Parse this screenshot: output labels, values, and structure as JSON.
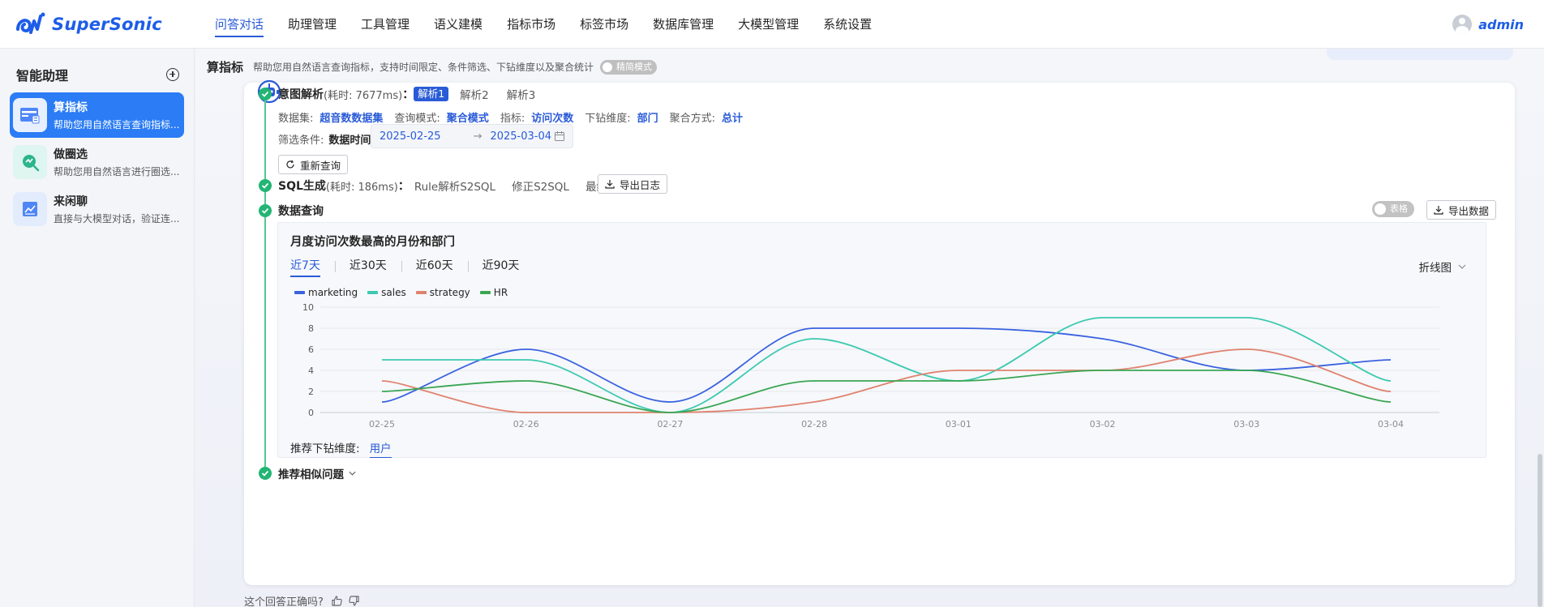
{
  "app": {
    "name": "SuperSonic",
    "user": "admin"
  },
  "nav": [
    {
      "label": "问答对话",
      "active": true
    },
    {
      "label": "助理管理"
    },
    {
      "label": "工具管理"
    },
    {
      "label": "语义建模"
    },
    {
      "label": "指标市场"
    },
    {
      "label": "标签市场"
    },
    {
      "label": "数据库管理"
    },
    {
      "label": "大模型管理"
    },
    {
      "label": "系统设置"
    }
  ],
  "sidebar": {
    "title": "智能助理",
    "agents": [
      {
        "name": "算指标",
        "desc": "帮助您用自然语言查询指标...",
        "active": true,
        "icon": "metric-card-icon"
      },
      {
        "name": "做圈选",
        "desc": "帮助您用自然语言进行圈选...",
        "icon": "search-chart-icon"
      },
      {
        "name": "来闲聊",
        "desc": "直接与大模型对话，验证连...",
        "icon": "chat-chart-icon"
      }
    ]
  },
  "topbar": {
    "title": "算指标",
    "desc": "帮助您用自然语言查询指标，支持时间限定、条件筛选、下钻维度以及聚合统计",
    "simple_mode": "精简模式"
  },
  "intent": {
    "title": "意图解析",
    "elapsed": "(耗时: 7677ms)",
    "colon": "：",
    "parses": [
      "解析1",
      "解析2",
      "解析3"
    ],
    "dataset_label": "数据集:",
    "dataset": "超音数数据集",
    "query_mode_label": "查询模式:",
    "query_mode": "聚合模式",
    "metric_label": "指标:",
    "metric": "访问次数",
    "drill_label": "下钻维度:",
    "drill": "部门",
    "agg_label": "聚合方式:",
    "agg": "总计",
    "filter_label": "筛选条件:",
    "date_label": "数据时间:",
    "date_start": "2025-02-25",
    "date_sep": "→",
    "date_end": "2025-03-04",
    "requery": "重新查询"
  },
  "sql": {
    "title": "SQL生成",
    "elapsed": "(耗时: 186ms)",
    "colon": "：",
    "items": [
      "Rule解析S2SQL",
      "修正S2SQL",
      "最终执行SQL"
    ],
    "export_log": "导出日志"
  },
  "query": {
    "title": "数据查询",
    "table_toggle": "表格",
    "export_data": "导出数据"
  },
  "chart_panel": {
    "title": "月度访问次数最高的月份和部门",
    "ranges": [
      "近7天",
      "近30天",
      "近60天",
      "近90天"
    ],
    "chart_type": "折线图",
    "drill_label": "推荐下钻维度:",
    "drill_value": "用户"
  },
  "similar": {
    "title": "推荐相似问题"
  },
  "feedback": {
    "question": "这个回答正确吗?"
  },
  "chart_data": {
    "type": "line",
    "categories": [
      "02-25",
      "02-26",
      "02-27",
      "02-28",
      "03-01",
      "03-02",
      "03-03",
      "03-04"
    ],
    "ylim": [
      0,
      10
    ],
    "yticks": [
      0,
      2,
      4,
      6,
      8,
      10
    ],
    "grid": true,
    "legend": "top-left",
    "series": [
      {
        "name": "marketing",
        "color": "#3a62e0",
        "values": [
          1,
          6,
          1,
          8,
          8,
          7,
          4,
          5
        ]
      },
      {
        "name": "sales",
        "color": "#3cc9b0",
        "values": [
          5,
          5,
          0,
          7,
          3,
          9,
          9,
          3
        ]
      },
      {
        "name": "strategy",
        "color": "#e0826f",
        "values": [
          3,
          0,
          0,
          1,
          4,
          4,
          6,
          2
        ]
      },
      {
        "name": "HR",
        "color": "#3aa653",
        "values": [
          2,
          3,
          0,
          3,
          3,
          4,
          4,
          1
        ]
      }
    ]
  }
}
